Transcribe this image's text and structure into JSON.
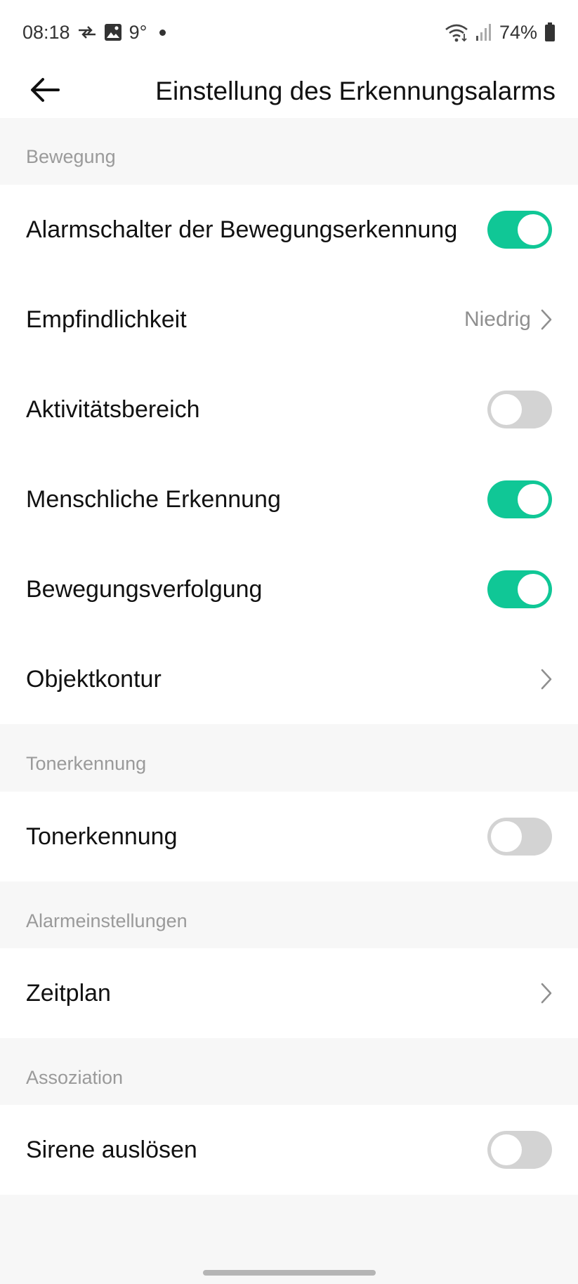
{
  "status_bar": {
    "time": "08:18",
    "temperature": "9°",
    "battery": "74%",
    "icons": [
      "data-transfer-icon",
      "gallery-icon",
      "wifi-icon",
      "signal-icon",
      "battery-icon"
    ]
  },
  "header": {
    "back_icon": "arrow-left-icon",
    "title": "Einstellung des Erkennungsalarms"
  },
  "sections": {
    "motion": {
      "label": "Bewegung",
      "rows": {
        "motion_alarm": {
          "label": "Alarmschalter der Bewegungserkennung",
          "toggle": true
        },
        "sensitivity": {
          "label": "Empfindlichkeit",
          "value": "Niedrig"
        },
        "activity_zone": {
          "label": "Aktivitätsbereich",
          "toggle": false
        },
        "human_detection": {
          "label": "Menschliche Erkennung",
          "toggle": true
        },
        "motion_tracking": {
          "label": "Bewegungsverfolgung",
          "toggle": true
        },
        "object_outline": {
          "label": "Objektkontur"
        }
      }
    },
    "sound": {
      "label": "Tonerkennung",
      "rows": {
        "sound_detection": {
          "label": "Tonerkennung",
          "toggle": false
        }
      }
    },
    "alarm_settings": {
      "label": "Alarmeinstellungen",
      "rows": {
        "schedule": {
          "label": "Zeitplan"
        }
      }
    },
    "association": {
      "label": "Assoziation",
      "rows": {
        "siren": {
          "label": "Sirene auslösen",
          "toggle": false
        }
      }
    }
  },
  "colors": {
    "toggle_on": "#10c796",
    "toggle_off": "#d3d3d3",
    "background": "#f7f7f7",
    "card": "#ffffff",
    "section_label": "#9a9a9a"
  }
}
